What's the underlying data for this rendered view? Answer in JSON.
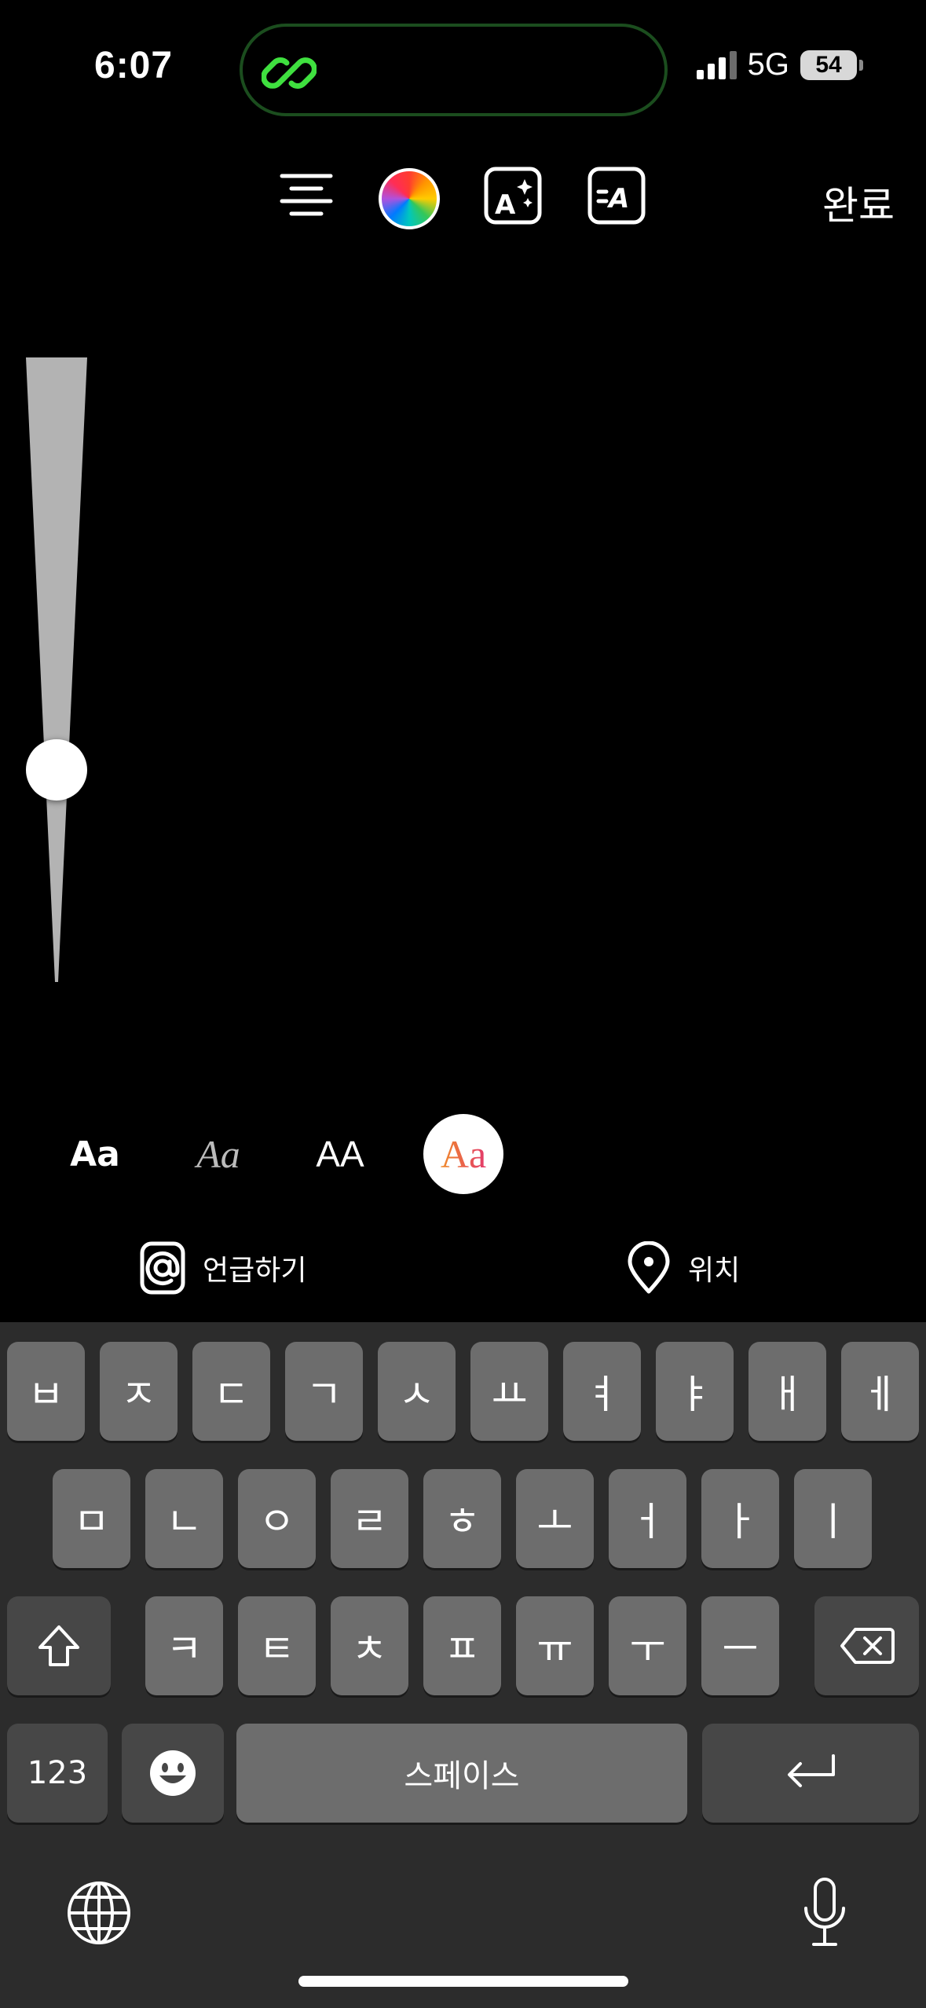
{
  "status_bar": {
    "time": "6:07",
    "network": "5G",
    "battery": "54"
  },
  "toolbar": {
    "icons": [
      "align-center-icon",
      "color-wheel-icon",
      "text-effects-icon",
      "text-animation-icon"
    ],
    "done_label": "완료"
  },
  "size_slider": {
    "level": 0.3
  },
  "font_styles": {
    "items": [
      {
        "label": "Aa",
        "selected": false
      },
      {
        "label": "Aa",
        "selected": false
      },
      {
        "label": "AA",
        "selected": false
      },
      {
        "label": "Aa",
        "selected": true
      }
    ]
  },
  "actions": {
    "mention_label": "언급하기",
    "location_label": "위치"
  },
  "keyboard": {
    "row1": [
      "ㅂ",
      "ㅈ",
      "ㄷ",
      "ㄱ",
      "ㅅ",
      "ㅛ",
      "ㅕ",
      "ㅑ",
      "ㅐ",
      "ㅔ"
    ],
    "row2": [
      "ㅁ",
      "ㄴ",
      "ㅇ",
      "ㄹ",
      "ㅎ",
      "ㅗ",
      "ㅓ",
      "ㅏ",
      "ㅣ"
    ],
    "row3": [
      "ㅋ",
      "ㅌ",
      "ㅊ",
      "ㅍ",
      "ㅠ",
      "ㅜ",
      "ㅡ"
    ],
    "numbers_label": "123",
    "space_label": "스페이스"
  },
  "colors": {
    "island_border": "#1b4d1e",
    "link_icon": "#3fe03f",
    "keyboard_bg": "#2c2c2c",
    "key_bg": "#6d6d6d",
    "function_key_bg": "#474747"
  }
}
